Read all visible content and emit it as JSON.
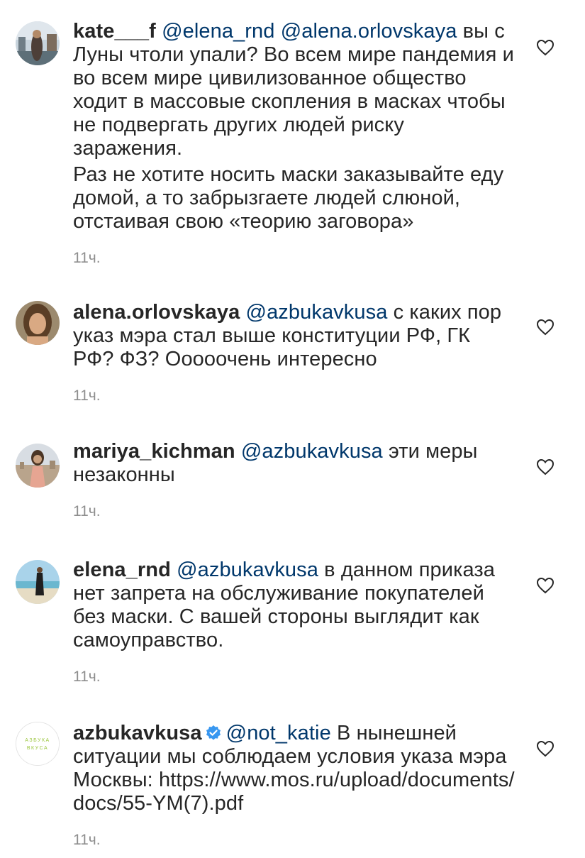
{
  "comments": [
    {
      "username": "kate___f",
      "mentions": [
        "@elena_rnd",
        "@alena.orlovskaya"
      ],
      "text": "вы с Луны чтоли упали? Во всем мире пандемия и во всем мире цивилизованное общество ходит в массовые скопления в масках чтобы не подвергать других людей риску заражения.",
      "text2": "Раз не хотите носить маски заказывайте еду домой, а то забрызгаете людей слюной, отстаивая свою «теорию заговора»",
      "time": "11ч.",
      "avatar_icon": "photo-venice-icon"
    },
    {
      "username": "alena.orlovskaya",
      "mentions": [
        "@azbukavkusa"
      ],
      "text": "с каких пор указ мэра стал выше конституции РФ, ГК РФ? ФЗ? Ооооочень интересно",
      "time": "11ч.",
      "avatar_icon": "photo-portrait-icon"
    },
    {
      "username": "mariya_kichman",
      "mentions": [
        "@azbukavkusa"
      ],
      "text": "эти меры незаконны",
      "time": "11ч.",
      "avatar_icon": "photo-city-icon"
    },
    {
      "username": "elena_rnd",
      "mentions": [
        "@azbukavkusa"
      ],
      "text": "в данном приказа нет запрета на обслуживание покупателей без маски. С вашей стороны выглядит как самоуправство.",
      "time": "11ч.",
      "avatar_icon": "photo-beach-icon"
    },
    {
      "username": "azbukavkusa",
      "verified": true,
      "mentions": [
        "@not_katie"
      ],
      "text": "В нынешней ситуации мы соблюдаем условия указа мэра Москвы:",
      "link": "https://www.mos.ru/upload/documents/docs/55-YM(7).pdf",
      "time": "11ч.",
      "avatar_icon": "azbuka-vkusa-logo",
      "logo_text": [
        "АЗБУКА",
        "ВКУСА"
      ]
    }
  ],
  "colors": {
    "mention": "#00376b",
    "text": "#262626",
    "meta": "#8e8e8e",
    "verified": "#3897f0",
    "logo": "#9bc53d"
  }
}
